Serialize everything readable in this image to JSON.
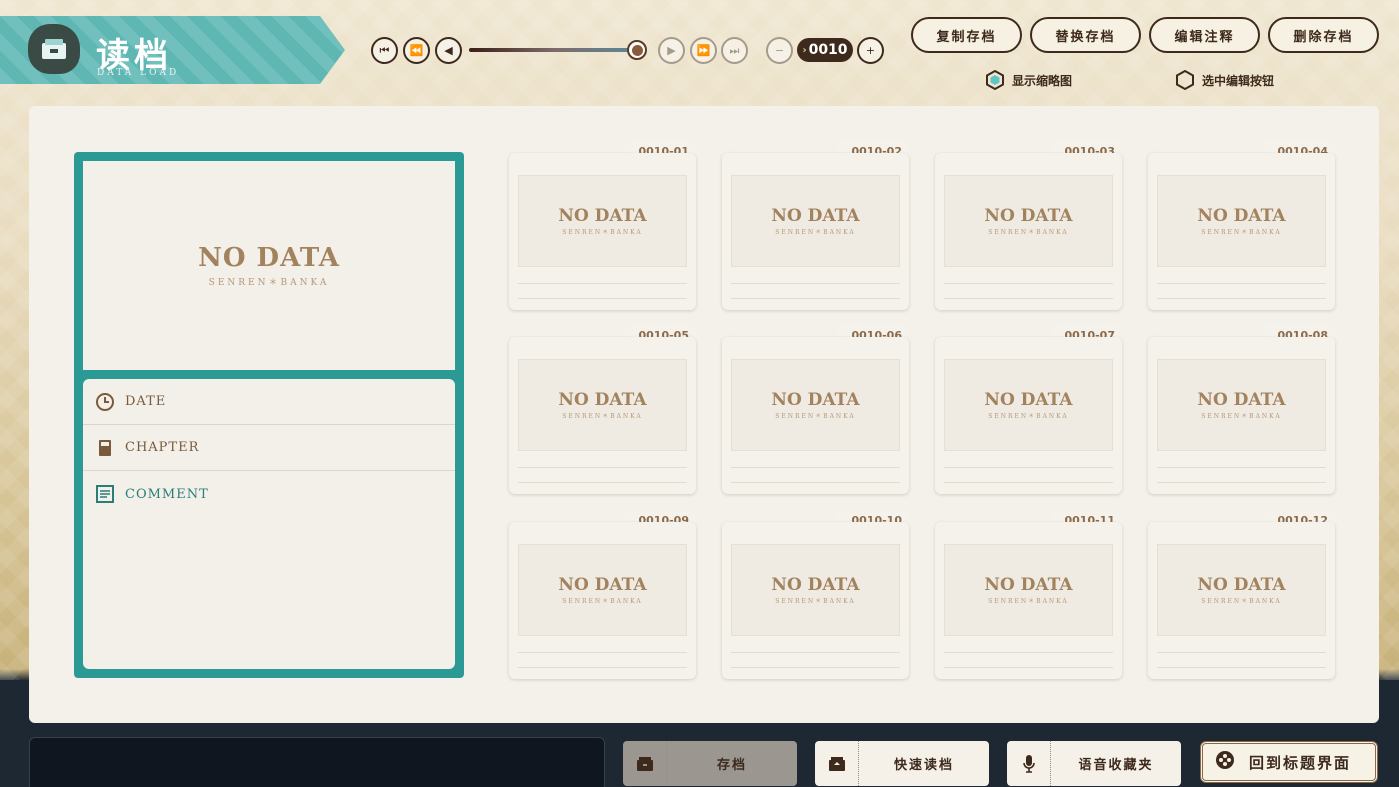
{
  "header": {
    "title": "读档",
    "subtitle": "DATA LOAD",
    "title_icon": "save-box-icon"
  },
  "pager": {
    "first_icon": "skip-first-icon",
    "prev_page_icon": "step-back-icon",
    "prev_icon": "play-back-icon",
    "next_icon": "play-icon",
    "next_page_icon": "step-forward-icon",
    "last_icon": "skip-last-icon",
    "minus_icon": "minus-icon",
    "plus_icon": "plus-icon",
    "page_value": "0010",
    "slider_progress": 1.0
  },
  "actions": {
    "copy": "复制存档",
    "replace": "替换存档",
    "edit_note": "编辑注释",
    "delete": "删除存档"
  },
  "toggles": {
    "show_thumbnail": "显示缩略图",
    "show_thumbnail_on": true,
    "select_edit": "选中编辑按钮",
    "select_edit_on": false
  },
  "preview": {
    "no_data": "NO DATA",
    "brand": "SENREN＊BANKA",
    "date_label": "DATE",
    "chapter_label": "CHAPTER",
    "comment_label": "COMMENT"
  },
  "slots": [
    {
      "id": "0010-01",
      "no_data": "NO DATA",
      "brand": "SENREN＊BANKA"
    },
    {
      "id": "0010-02",
      "no_data": "NO DATA",
      "brand": "SENREN＊BANKA"
    },
    {
      "id": "0010-03",
      "no_data": "NO DATA",
      "brand": "SENREN＊BANKA"
    },
    {
      "id": "0010-04",
      "no_data": "NO DATA",
      "brand": "SENREN＊BANKA"
    },
    {
      "id": "0010-05",
      "no_data": "NO DATA",
      "brand": "SENREN＊BANKA"
    },
    {
      "id": "0010-06",
      "no_data": "NO DATA",
      "brand": "SENREN＊BANKA"
    },
    {
      "id": "0010-07",
      "no_data": "NO DATA",
      "brand": "SENREN＊BANKA"
    },
    {
      "id": "0010-08",
      "no_data": "NO DATA",
      "brand": "SENREN＊BANKA"
    },
    {
      "id": "0010-09",
      "no_data": "NO DATA",
      "brand": "SENREN＊BANKA"
    },
    {
      "id": "0010-10",
      "no_data": "NO DATA",
      "brand": "SENREN＊BANKA"
    },
    {
      "id": "0010-11",
      "no_data": "NO DATA",
      "brand": "SENREN＊BANKA"
    },
    {
      "id": "0010-12",
      "no_data": "NO DATA",
      "brand": "SENREN＊BANKA"
    }
  ],
  "bottom": {
    "save": "存档",
    "quick_load": "快速读档",
    "voice_favorites": "语音收藏夹",
    "back_to_title": "回到标题界面"
  },
  "colors": {
    "accent_teal": "#2b9a94",
    "text_brown": "#3e2a1c",
    "nodata_gold": "#a3835e"
  }
}
